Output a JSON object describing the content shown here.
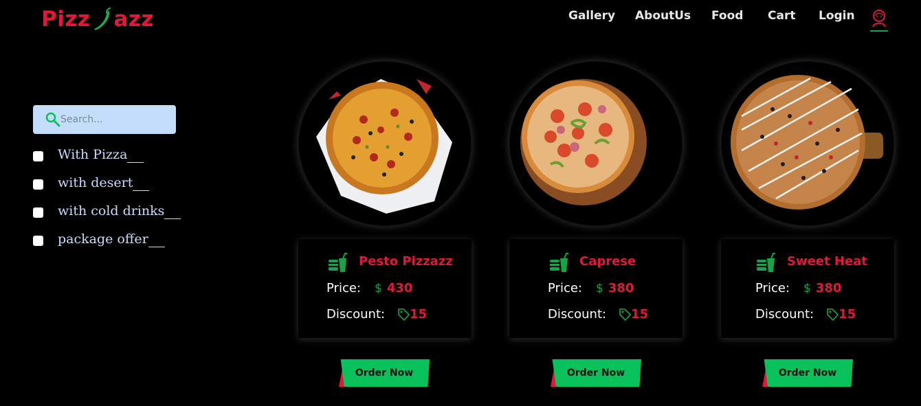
{
  "brand": {
    "name_start": "Pizz",
    "name_end": "azz",
    "accent": "#e0183a",
    "green": "#09c15a"
  },
  "nav": {
    "items": [
      "Gallery",
      "AboutUs",
      "Food",
      "Cart",
      "Login"
    ],
    "user_icon": "user-avatar-icon"
  },
  "search": {
    "placeholder": "Search...",
    "value": "",
    "icon": "search-icon"
  },
  "filters": [
    {
      "label": "With Pizza",
      "checked": false
    },
    {
      "label": "with desert",
      "checked": false
    },
    {
      "label": "with cold drinks",
      "checked": false
    },
    {
      "label": "package offer",
      "checked": false
    }
  ],
  "products": [
    {
      "name": "Pesto Pizzazz",
      "price_label": "Price:",
      "currency": "$",
      "price": "430",
      "discount_label": "Discount:",
      "discount": "15",
      "button": "Order Now"
    },
    {
      "name": "Caprese",
      "price_label": "Price:",
      "currency": "$",
      "price": "380",
      "discount_label": "Discount:",
      "discount": "15",
      "button": "Order Now"
    },
    {
      "name": "Sweet Heat",
      "price_label": "Price:",
      "currency": "$",
      "price": "380",
      "discount_label": "Discount:",
      "discount": "15",
      "button": "Order Now"
    }
  ]
}
